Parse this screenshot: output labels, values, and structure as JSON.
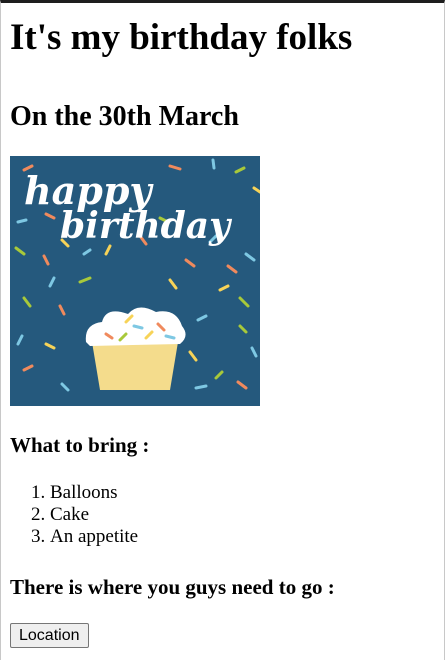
{
  "heading": "It's my birthday folks",
  "subheading": "On the 30th March",
  "card": {
    "line1": "happy",
    "line2": "birthday",
    "colors": {
      "background": "#25597d",
      "cake": "#f4dc8c",
      "frosting": "#ffffff"
    }
  },
  "bring": {
    "title": "What to bring :",
    "items": [
      "Balloons",
      "Cake",
      "An appetite"
    ]
  },
  "go": {
    "title": "There is where you guys need to go :",
    "button_label": "Location"
  }
}
